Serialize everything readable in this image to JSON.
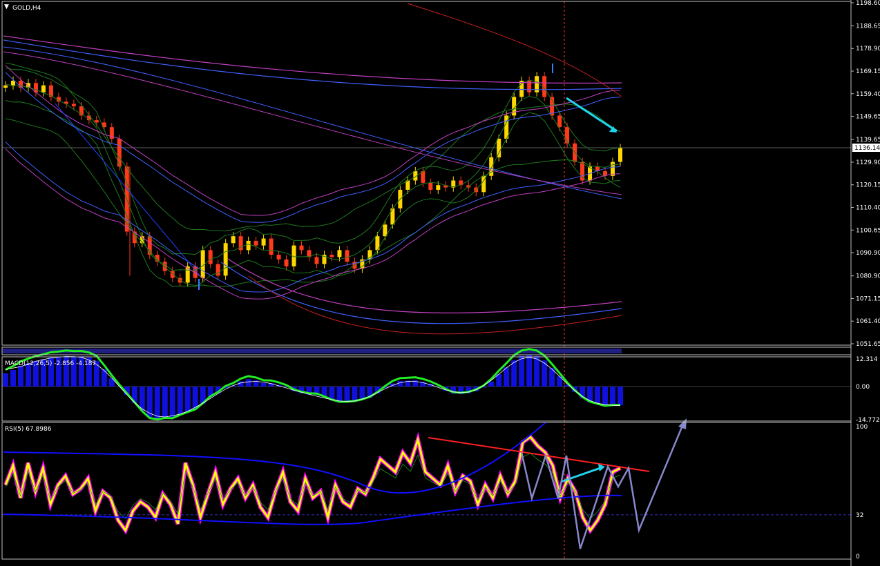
{
  "window": {
    "symbol_title": "GOLD,H4"
  },
  "price_pane": {
    "ticks": [
      "1198.60",
      "1188.65",
      "1178.90",
      "1169.15",
      "1159.40",
      "1149.65",
      "1139.65",
      "1129.90",
      "1120.15",
      "1110.40",
      "1100.65",
      "1090.90",
      "1080.90",
      "1071.15",
      "1061.40",
      "1051.65"
    ],
    "current_price": "1136.14"
  },
  "macd_pane": {
    "title": "MACD(12,26,5) -2.856 -4.187",
    "ticks": [
      "12.314",
      "0.00",
      "-14.772"
    ]
  },
  "rsi_pane": {
    "title": "RSI(5) 67.8986",
    "ticks": [
      "100",
      "32",
      "0"
    ]
  },
  "colors": {
    "background": "#000000",
    "grid_border": "#c0c0c0",
    "bull_candle": "#ffd700",
    "bear_candle": "#ff3a1a",
    "envelope_blue": "#4060ff",
    "envelope_magenta": "#c040c0",
    "bollinger_green": "#1e7a1e",
    "annotation_cyan": "#22d3ee",
    "annotation_red": "#ff2020",
    "annotation_gray": "#8888cc",
    "rsi_yellow": "#ffff00",
    "rsi_magenta": "#ff00ff",
    "macd_green": "#22ee22",
    "macd_hist_blue": "#1010dd"
  },
  "chart_data": [
    {
      "type": "candlestick",
      "symbol": "GOLD",
      "timeframe": "H4",
      "ylim": [
        1051.65,
        1198.6
      ],
      "current_price": 1136.14,
      "close_approx": [
        1163,
        1165,
        1162,
        1164,
        1160,
        1163,
        1158,
        1156,
        1155,
        1154,
        1150,
        1148,
        1147,
        1145,
        1140,
        1128,
        1100,
        1095,
        1098,
        1090,
        1087,
        1083,
        1080,
        1078,
        1085,
        1080,
        1092,
        1086,
        1081,
        1095,
        1098,
        1092,
        1096,
        1094,
        1097,
        1090,
        1088,
        1085,
        1094,
        1092,
        1089,
        1086,
        1090,
        1089,
        1092,
        1087,
        1084,
        1088,
        1092,
        1098,
        1103,
        1110,
        1118,
        1122,
        1126,
        1121,
        1118,
        1120,
        1119,
        1122,
        1120,
        1119,
        1117,
        1124,
        1132,
        1140,
        1150,
        1158,
        1165,
        1160,
        1167,
        1158,
        1150,
        1145,
        1138,
        1130,
        1122,
        1128,
        1126,
        1124,
        1130,
        1136
      ]
    },
    {
      "type": "macd",
      "params": [
        12,
        26,
        5
      ],
      "macd": -2.856,
      "signal": -4.187,
      "ylim": [
        -14.772,
        12.314
      ]
    },
    {
      "type": "line",
      "indicator": "RSI",
      "period": 5,
      "last_value": 67.8986,
      "ylim": [
        0,
        100
      ],
      "level_line": 32,
      "values_approx": [
        55,
        70,
        45,
        72,
        50,
        68,
        40,
        55,
        62,
        48,
        52,
        60,
        35,
        50,
        45,
        28,
        20,
        35,
        42,
        38,
        30,
        48,
        40,
        25,
        72,
        55,
        30,
        48,
        65,
        40,
        52,
        60,
        45,
        55,
        38,
        30,
        50,
        65,
        42,
        35,
        60,
        45,
        50,
        30,
        55,
        42,
        38,
        52,
        48,
        60,
        75,
        70,
        65,
        80,
        72,
        90,
        65,
        60,
        55,
        70,
        50,
        62,
        58,
        40,
        55,
        45,
        62,
        48,
        58,
        88,
        92,
        85,
        80,
        70,
        45,
        60,
        50,
        30,
        20,
        28,
        40,
        65,
        68
      ]
    }
  ]
}
